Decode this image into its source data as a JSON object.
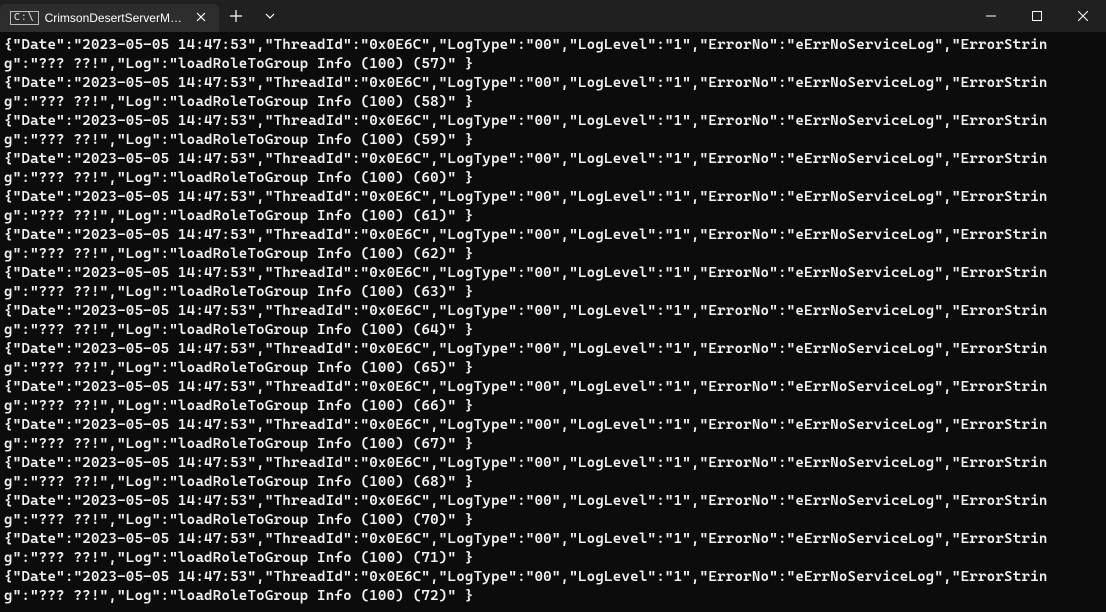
{
  "window": {
    "tab_title": "CrimsonDesertServerManager"
  },
  "log_template": {
    "Date": "2023-05-05 14:47:53",
    "ThreadId": "0x0E6C",
    "LogType": "00",
    "LogLevel": "1",
    "ErrorNo": "eErrNoServiceLog",
    "ErrorString": "??? ??!",
    "LogPrefix": "loadRoleToGroup Info (100) "
  },
  "log_sequence": [
    57,
    58,
    59,
    60,
    61,
    62,
    63,
    64,
    65,
    66,
    67,
    68,
    70,
    71,
    72
  ],
  "rendered_lines": [
    "{\"Date\":\"2023-05-05 14:47:53\",\"ThreadId\":\"0x0E6C\",\"LogType\":\"00\",\"LogLevel\":\"1\",\"ErrorNo\":\"eErrNoServiceLog\",\"ErrorString\":\"??? ??!\",\"Log\":\"loadRoleToGroup Info (100) (57)\" }",
    "{\"Date\":\"2023-05-05 14:47:53\",\"ThreadId\":\"0x0E6C\",\"LogType\":\"00\",\"LogLevel\":\"1\",\"ErrorNo\":\"eErrNoServiceLog\",\"ErrorString\":\"??? ??!\",\"Log\":\"loadRoleToGroup Info (100) (58)\" }",
    "{\"Date\":\"2023-05-05 14:47:53\",\"ThreadId\":\"0x0E6C\",\"LogType\":\"00\",\"LogLevel\":\"1\",\"ErrorNo\":\"eErrNoServiceLog\",\"ErrorString\":\"??? ??!\",\"Log\":\"loadRoleToGroup Info (100) (59)\" }",
    "{\"Date\":\"2023-05-05 14:47:53\",\"ThreadId\":\"0x0E6C\",\"LogType\":\"00\",\"LogLevel\":\"1\",\"ErrorNo\":\"eErrNoServiceLog\",\"ErrorString\":\"??? ??!\",\"Log\":\"loadRoleToGroup Info (100) (60)\" }",
    "{\"Date\":\"2023-05-05 14:47:53\",\"ThreadId\":\"0x0E6C\",\"LogType\":\"00\",\"LogLevel\":\"1\",\"ErrorNo\":\"eErrNoServiceLog\",\"ErrorString\":\"??? ??!\",\"Log\":\"loadRoleToGroup Info (100) (61)\" }",
    "{\"Date\":\"2023-05-05 14:47:53\",\"ThreadId\":\"0x0E6C\",\"LogType\":\"00\",\"LogLevel\":\"1\",\"ErrorNo\":\"eErrNoServiceLog\",\"ErrorString\":\"??? ??!\",\"Log\":\"loadRoleToGroup Info (100) (62)\" }",
    "{\"Date\":\"2023-05-05 14:47:53\",\"ThreadId\":\"0x0E6C\",\"LogType\":\"00\",\"LogLevel\":\"1\",\"ErrorNo\":\"eErrNoServiceLog\",\"ErrorString\":\"??? ??!\",\"Log\":\"loadRoleToGroup Info (100) (63)\" }",
    "{\"Date\":\"2023-05-05 14:47:53\",\"ThreadId\":\"0x0E6C\",\"LogType\":\"00\",\"LogLevel\":\"1\",\"ErrorNo\":\"eErrNoServiceLog\",\"ErrorString\":\"??? ??!\",\"Log\":\"loadRoleToGroup Info (100) (64)\" }",
    "{\"Date\":\"2023-05-05 14:47:53\",\"ThreadId\":\"0x0E6C\",\"LogType\":\"00\",\"LogLevel\":\"1\",\"ErrorNo\":\"eErrNoServiceLog\",\"ErrorString\":\"??? ??!\",\"Log\":\"loadRoleToGroup Info (100) (65)\" }",
    "{\"Date\":\"2023-05-05 14:47:53\",\"ThreadId\":\"0x0E6C\",\"LogType\":\"00\",\"LogLevel\":\"1\",\"ErrorNo\":\"eErrNoServiceLog\",\"ErrorString\":\"??? ??!\",\"Log\":\"loadRoleToGroup Info (100) (66)\" }",
    "{\"Date\":\"2023-05-05 14:47:53\",\"ThreadId\":\"0x0E6C\",\"LogType\":\"00\",\"LogLevel\":\"1\",\"ErrorNo\":\"eErrNoServiceLog\",\"ErrorString\":\"??? ??!\",\"Log\":\"loadRoleToGroup Info (100) (67)\" }",
    "{\"Date\":\"2023-05-05 14:47:53\",\"ThreadId\":\"0x0E6C\",\"LogType\":\"00\",\"LogLevel\":\"1\",\"ErrorNo\":\"eErrNoServiceLog\",\"ErrorString\":\"??? ??!\",\"Log\":\"loadRoleToGroup Info (100) (68)\" }",
    "{\"Date\":\"2023-05-05 14:47:53\",\"ThreadId\":\"0x0E6C\",\"LogType\":\"00\",\"LogLevel\":\"1\",\"ErrorNo\":\"eErrNoServiceLog\",\"ErrorString\":\"??? ??!\",\"Log\":\"loadRoleToGroup Info (100) (70)\" }",
    "{\"Date\":\"2023-05-05 14:47:53\",\"ThreadId\":\"0x0E6C\",\"LogType\":\"00\",\"LogLevel\":\"1\",\"ErrorNo\":\"eErrNoServiceLog\",\"ErrorString\":\"??? ??!\",\"Log\":\"loadRoleToGroup Info (100) (71)\" }",
    "{\"Date\":\"2023-05-05 14:47:53\",\"ThreadId\":\"0x0E6C\",\"LogType\":\"00\",\"LogLevel\":\"1\",\"ErrorNo\":\"eErrNoServiceLog\",\"ErrorString\":\"??? ??!\",\"Log\":\"loadRoleToGroup Info (100) (72)\" }"
  ]
}
